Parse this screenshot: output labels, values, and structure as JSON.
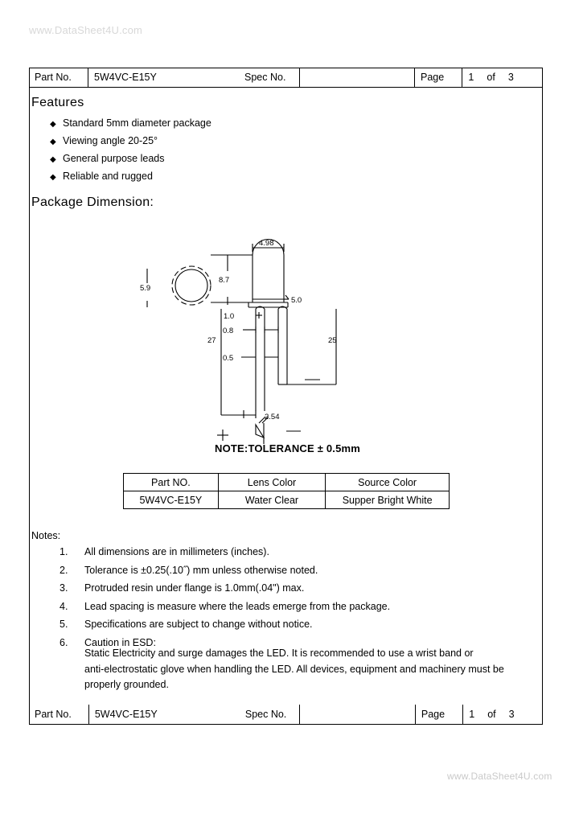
{
  "watermark": {
    "top": "www.DataSheet4U.com",
    "bottom": "www.DataSheet4U.com"
  },
  "header": {
    "part_no_label": "Part No.",
    "part_no_value": "5W4VC-E15Y",
    "spec_no_label": "Spec No.",
    "spec_no_value": "",
    "page_label": "Page",
    "page_current": "1",
    "page_of": "of",
    "page_total": "3"
  },
  "features": {
    "title": "Features",
    "bullet": "◆",
    "items": [
      "Standard 5mm diameter package",
      "Viewing angle 20-25°",
      "General purpose leads",
      "Reliable and rugged"
    ]
  },
  "package_dimension": {
    "title": "Package Dimension:",
    "note": "NOTE:TOLERANCE ± 0.5mm",
    "dimensions": {
      "top_view_diameter": "5.9",
      "lens_diameter": "4.98",
      "total_height": "8.7",
      "lens_height": "5.0",
      "flange_thickness": "1.0",
      "flange_step": "0.8",
      "lead_width": "0.5",
      "lead_pitch": "2.54",
      "anode_lead_length": "27",
      "cathode_lead_length": "25"
    },
    "polarity": {
      "anode": "+",
      "cathode": "—"
    }
  },
  "part_table": {
    "headers": [
      "Part NO.",
      "Lens Color",
      "Source Color"
    ],
    "rows": [
      [
        "5W4VC-E15Y",
        "Water Clear",
        "Supper Bright White"
      ]
    ]
  },
  "notes": {
    "title": "Notes:",
    "items": [
      {
        "num": "1.",
        "text": "All dimensions are in millimeters (inches)."
      },
      {
        "num": "2.",
        "text": "Tolerance is ±0.25(.10˝) mm unless otherwise noted."
      },
      {
        "num": "3.",
        "text": "Protruded resin under flange is 1.0mm(.04\") max."
      },
      {
        "num": "4.",
        "text": "Lead spacing is measure where the leads emerge from the package."
      },
      {
        "num": "5.",
        "text": "Specifications are subject to change without notice."
      },
      {
        "num": "6.",
        "text": "Caution in ESD:"
      }
    ],
    "esd_paragraph_line1": "Static Electricity and surge damages the LED. It is recommended to use a wrist band or",
    "esd_paragraph_line2": "anti-electrostatic glove when handling the LED. All devices, equipment and machinery must be",
    "esd_paragraph_line3": "properly grounded."
  },
  "footer": {
    "part_no_label": "Part No.",
    "part_no_value": "5W4VC-E15Y",
    "spec_no_label": "Spec No.",
    "spec_no_value": "",
    "page_label": "Page",
    "page_current": "1",
    "page_of": "of",
    "page_total": "3"
  }
}
